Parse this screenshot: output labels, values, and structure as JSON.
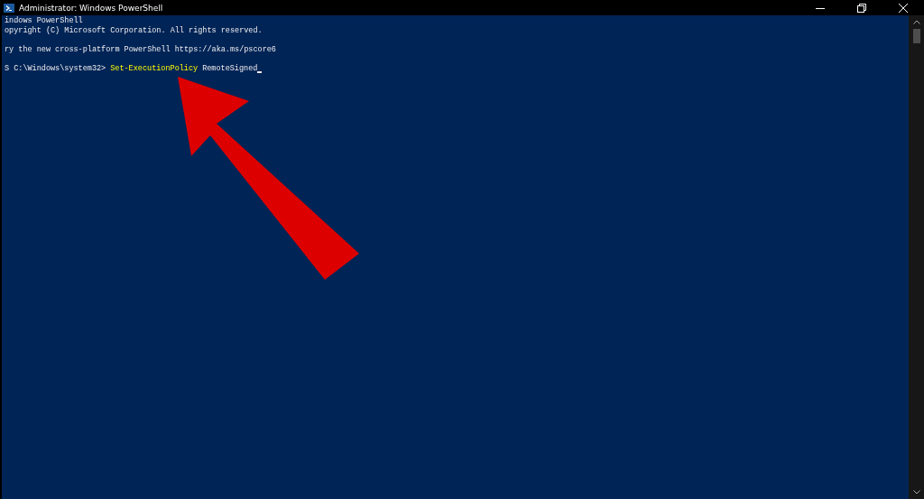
{
  "window": {
    "title": "Administrator: Windows PowerShell"
  },
  "console": {
    "lines": [
      {
        "kind": "text",
        "text": "indows PowerShell"
      },
      {
        "kind": "text",
        "text": "opyright (C) Microsoft Corporation. All rights reserved."
      },
      {
        "kind": "blank"
      },
      {
        "kind": "text",
        "text": "ry the new cross-platform PowerShell https://aka.ms/pscore6"
      },
      {
        "kind": "blank"
      },
      {
        "kind": "prompt",
        "prompt": "S C:\\Windows\\system32>",
        "command": "Set-ExecutionPolicy",
        "argument": "RemoteSigned"
      }
    ]
  }
}
